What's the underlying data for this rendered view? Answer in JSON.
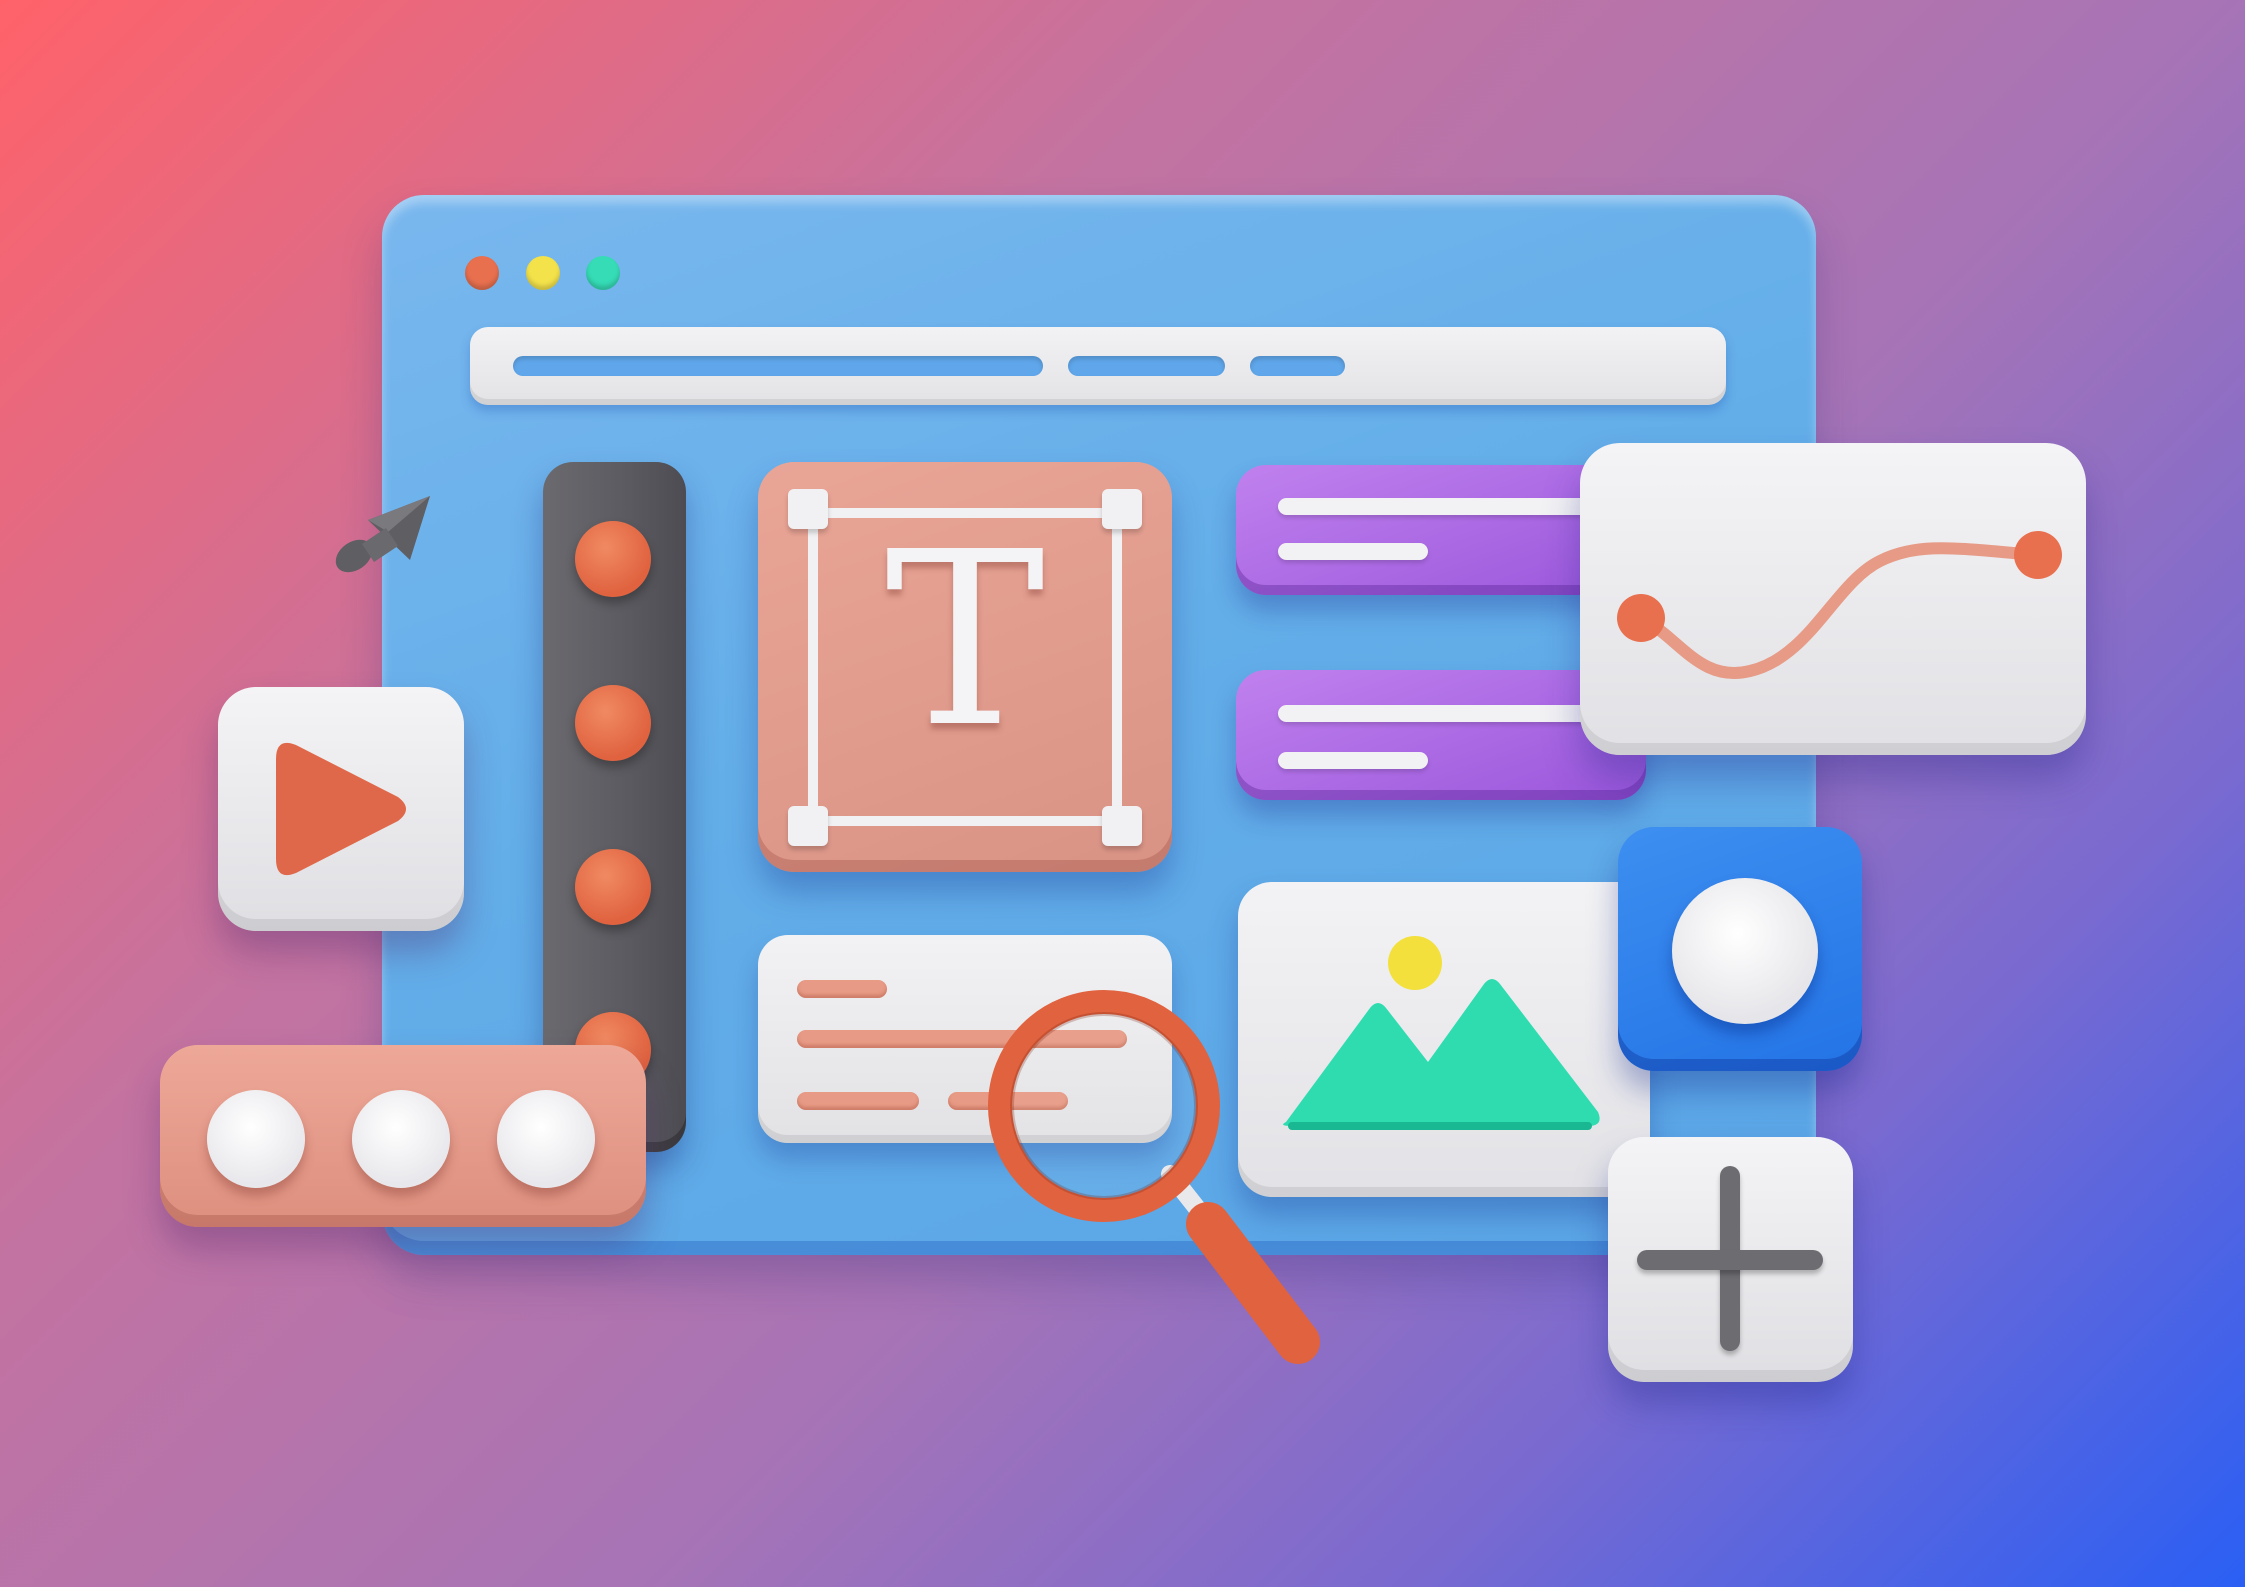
{
  "scene": {
    "window_dots": [
      "red",
      "yellow",
      "green"
    ],
    "text_card": {
      "glyph": "T"
    },
    "slider": {
      "knob_count": 4
    },
    "options": {
      "dot_count": 3
    },
    "icons": [
      "cursor-icon",
      "play-icon",
      "magnifier-icon",
      "mountain-image-icon",
      "sun-icon",
      "plus-icon",
      "curve-graph-icon"
    ]
  },
  "colors": {
    "window_blue": "#63aee9",
    "accent_orange": "#e0623f",
    "salmon": "#e79a85",
    "purple": "#9a56db",
    "mint": "#2fdcb0",
    "yellow": "#f4e24a",
    "slate": "#5b5a60",
    "card_white": "#f2f2f4"
  }
}
